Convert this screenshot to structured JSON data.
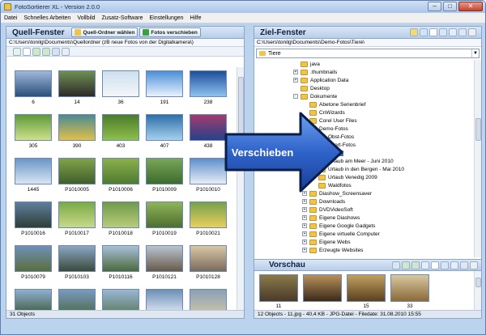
{
  "window": {
    "title": "FotoSortierer XL - Version 2.0.0"
  },
  "menu": [
    "Datei",
    "Schnelles Arbeiten",
    "Vollbild",
    "Zusatz-Software",
    "Einstellungen",
    "Hilfe"
  ],
  "left_panel": {
    "title": "Quell-Fenster",
    "btn_choose": "Quell-Ordner wählen",
    "btn_move": "Fotos verschieben",
    "path": "C:\\Users\\tonilg\\Documents\\Quellordner (zB neue Fotos von der Digitalkamera\\)",
    "status": "31 Objects",
    "thumbs": [
      {
        "label": "6",
        "colors": [
          "#9fb8d9",
          "#2b4f7a"
        ]
      },
      {
        "label": "14",
        "colors": [
          "#6f8f55",
          "#2d2a26"
        ]
      },
      {
        "label": "36",
        "colors": [
          "#cde0ef",
          "#f4f6f8"
        ]
      },
      {
        "label": "191",
        "colors": [
          "#4a8fd6",
          "#eaf2ff"
        ]
      },
      {
        "label": "238",
        "colors": [
          "#1d4f9a",
          "#8fc1f0"
        ]
      },
      {
        "label": "305",
        "colors": [
          "#5f9a3a",
          "#cfe08a"
        ]
      },
      {
        "label": "390",
        "colors": [
          "#4d8a8f",
          "#e0c04a"
        ]
      },
      {
        "label": "403",
        "colors": [
          "#4b7b2b",
          "#8fbf4b"
        ]
      },
      {
        "label": "407",
        "colors": [
          "#2e6fa8",
          "#a6d0ee"
        ]
      },
      {
        "label": "438",
        "colors": [
          "#a23c6e",
          "#27408a"
        ]
      },
      {
        "label": "1445",
        "colors": [
          "#6a95c5",
          "#d8e6f3"
        ]
      },
      {
        "label": "P1010005",
        "colors": [
          "#7fa34b",
          "#405f2a"
        ]
      },
      {
        "label": "P1010006",
        "colors": [
          "#8bb04e",
          "#4f7a2e"
        ]
      },
      {
        "label": "P1010009",
        "colors": [
          "#7aa65a",
          "#3d6b2c"
        ]
      },
      {
        "label": "P1010010",
        "colors": [
          "#5d8fcb",
          "#e7eef6"
        ]
      },
      {
        "label": "P1010016",
        "colors": [
          "#5f7e9d",
          "#2f3f35"
        ]
      },
      {
        "label": "P1010017",
        "colors": [
          "#7aaa46",
          "#c9d98a"
        ]
      },
      {
        "label": "P1010018",
        "colors": [
          "#6f9a4a",
          "#b9cc7a"
        ]
      },
      {
        "label": "P1010019",
        "colors": [
          "#8fb35a",
          "#4e6e2e"
        ]
      },
      {
        "label": "P1010021",
        "colors": [
          "#77a04c",
          "#e8d05a"
        ]
      },
      {
        "label": "P1010079",
        "colors": [
          "#6f90b8",
          "#5a6e3c"
        ]
      },
      {
        "label": "P1010103",
        "colors": [
          "#8aa6c4",
          "#3b4b3a"
        ]
      },
      {
        "label": "P1010116",
        "colors": [
          "#a8c0da",
          "#4d6a3a"
        ]
      },
      {
        "label": "P1010121",
        "colors": [
          "#b8c4d0",
          "#6a5a4a"
        ]
      },
      {
        "label": "P1010128",
        "colors": [
          "#d8c8a8",
          "#7a6a5a"
        ]
      },
      {
        "label": "",
        "colors": [
          "#8fb0d0",
          "#3d5a3a"
        ]
      },
      {
        "label": "",
        "colors": [
          "#7a9ac0",
          "#4a6a4a"
        ]
      },
      {
        "label": "",
        "colors": [
          "#9ab6d6",
          "#5a7a5a"
        ]
      },
      {
        "label": "",
        "colors": [
          "#6d8fb8",
          "#e4ecf4"
        ]
      },
      {
        "label": "",
        "colors": [
          "#8aa0b8",
          "#d0c4a8"
        ]
      }
    ]
  },
  "right_panel": {
    "title": "Ziel-Fenster",
    "path": "C:\\Users\\tonilg\\Documents\\Demo-Fotos\\Tiere\\",
    "combo": "Tiere",
    "tree": [
      {
        "label": "java",
        "level": 3,
        "exp": ""
      },
      {
        "label": ".thumbnails",
        "level": 3,
        "exp": "+"
      },
      {
        "label": "Application Data",
        "level": 3,
        "exp": "+"
      },
      {
        "label": "Desktop",
        "level": 3,
        "exp": ""
      },
      {
        "label": "Dokumente",
        "level": 3,
        "exp": "-"
      },
      {
        "label": "Abetone Serienbrief",
        "level": 4,
        "exp": ""
      },
      {
        "label": "CnWizards",
        "level": 4,
        "exp": ""
      },
      {
        "label": "Corel User Files",
        "level": 4,
        "exp": ""
      },
      {
        "label": "Demo-Fotos",
        "level": 4,
        "exp": "-"
      },
      {
        "label": "Obst-Fotos",
        "level": 5,
        "exp": ""
      },
      {
        "label": "Sport-Fotos",
        "level": 5,
        "exp": ""
      },
      {
        "label": "Tiere",
        "level": 5,
        "exp": "",
        "selected": true
      },
      {
        "label": "Urlaub am Meer - Juni 2010",
        "level": 5,
        "exp": ""
      },
      {
        "label": "Urlaub in den Bergen - Mai 2010",
        "level": 5,
        "exp": ""
      },
      {
        "label": "Urlaub Venedig 2009",
        "level": 5,
        "exp": ""
      },
      {
        "label": "Waldfotos",
        "level": 5,
        "exp": ""
      },
      {
        "label": "Diashow_Screensaver",
        "level": 4,
        "exp": "+"
      },
      {
        "label": "Downloads",
        "level": 4,
        "exp": "+"
      },
      {
        "label": "DVDVideoSoft",
        "level": 4,
        "exp": "+"
      },
      {
        "label": "Eigene Diashows",
        "level": 4,
        "exp": "+"
      },
      {
        "label": "Eigene Google Gadgets",
        "level": 4,
        "exp": "+"
      },
      {
        "label": "Eigene virtuelle Computer",
        "level": 4,
        "exp": "+"
      },
      {
        "label": "Eigene Webs",
        "level": 4,
        "exp": "+"
      },
      {
        "label": "Erzeugte Websites",
        "level": 4,
        "exp": "+"
      }
    ],
    "preview_title": "Vorschau",
    "preview": [
      {
        "label": "11",
        "colors": [
          "#8a7a4a",
          "#4a3a2a"
        ]
      },
      {
        "label": "",
        "colors": [
          "#b8905a",
          "#3a2a1a"
        ]
      },
      {
        "label": "15",
        "colors": [
          "#c0a060",
          "#5a4020"
        ]
      },
      {
        "label": "33",
        "colors": [
          "#d8c8a0",
          "#8a6a3a"
        ]
      }
    ],
    "status": "12 Objects - 11.jpg - 40,4 KB - JPG-Datei - Filedate: 31.08.2010 15:55"
  },
  "overlay": {
    "label": "Verschieben"
  },
  "icons": [
    "app-icon",
    "minimize-icon",
    "maximize-icon",
    "close-icon",
    "folder-icon",
    "move-icon"
  ]
}
